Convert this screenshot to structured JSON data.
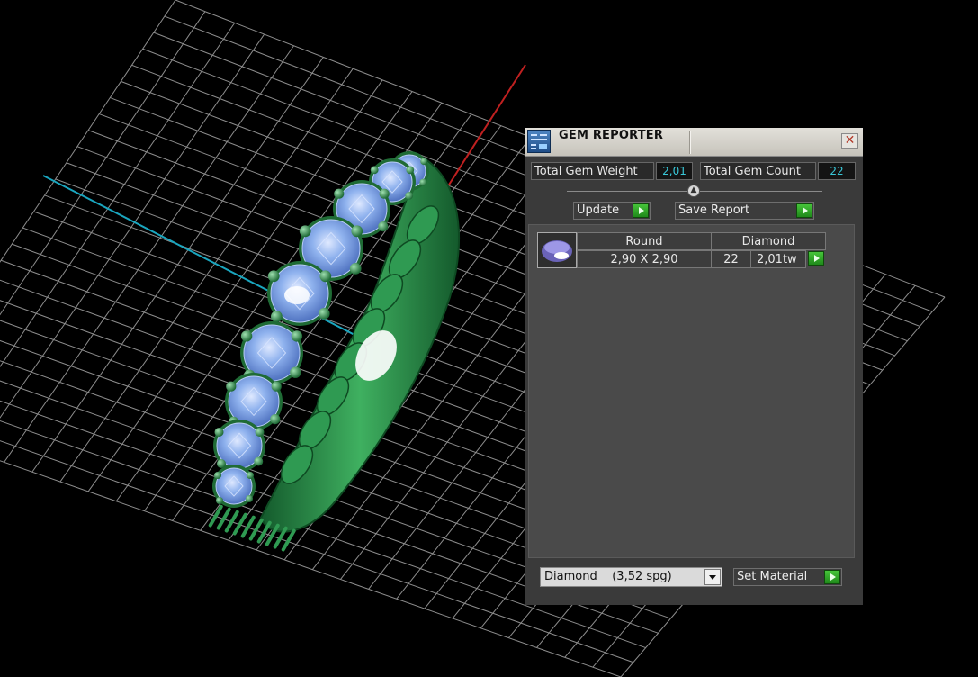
{
  "panel": {
    "title": "GEM REPORTER",
    "close_icon": "close-icon",
    "app_icon": "gem-reporter-icon"
  },
  "stats": {
    "total_weight_label": "Total Gem Weight",
    "total_weight_value": "2,01",
    "total_count_label": "Total Gem Count",
    "total_count_value": "22"
  },
  "buttons": {
    "update": "Update",
    "save_report": "Save Report",
    "set_material": "Set Material"
  },
  "report": {
    "gems": [
      {
        "thumbnail": "round-gem-icon",
        "shape": "Round",
        "material": "Diamond",
        "size": "2,90 X 2,90",
        "count": "22",
        "weight": "2,01tw"
      }
    ]
  },
  "material_select": {
    "value": "Diamond    (3,52 spg)"
  },
  "colors": {
    "stat_value": "#39c7d8",
    "go_button": "#2fae26",
    "gem_blue": "#8fb2ee",
    "metal_green": "#2f9a52",
    "axis_red": "#c02020",
    "axis_cyan": "#1aa6bf",
    "grid": "#9a9a9a"
  }
}
